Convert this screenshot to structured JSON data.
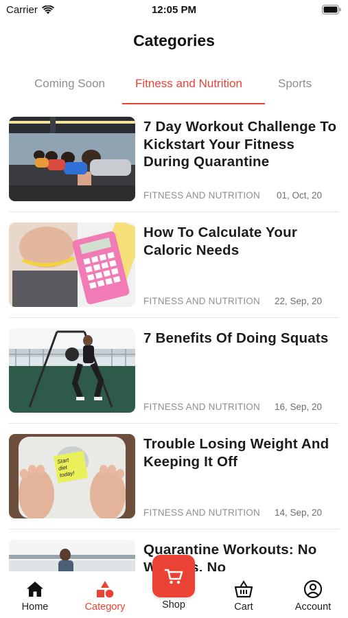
{
  "status_bar": {
    "carrier": "Carrier",
    "time": "12:05 PM"
  },
  "page": {
    "title": "Categories"
  },
  "tabs": [
    {
      "label": "Coming Soon",
      "active": false
    },
    {
      "label": "Fitness and Nutrition",
      "active": true
    },
    {
      "label": "Sports",
      "active": false
    }
  ],
  "articles": [
    {
      "title": "7 Day Workout Challenge To Kickstart Your Fitness During Quarantine",
      "category": "FITNESS AND NUTRITION",
      "date": "01, Oct, 20"
    },
    {
      "title": "How To Calculate Your Caloric Needs",
      "category": "FITNESS AND NUTRITION",
      "date": "22, Sep, 20"
    },
    {
      "title": "7 Benefits Of Doing Squats",
      "category": "FITNESS AND NUTRITION",
      "date": "16, Sep, 20"
    },
    {
      "title": "Trouble Losing Weight And Keeping It Off",
      "category": "FITNESS AND NUTRITION",
      "date": "14, Sep, 20"
    },
    {
      "title": "Quarantine Workouts: No Weights, No",
      "category": "",
      "date": ""
    }
  ],
  "scale_note": "Start diet today!",
  "tab_bar": {
    "home": "Home",
    "category": "Category",
    "shop": "Shop",
    "cart": "Cart",
    "account": "Account"
  },
  "colors": {
    "accent": "#ea4335",
    "muted": "#8e8e93"
  }
}
